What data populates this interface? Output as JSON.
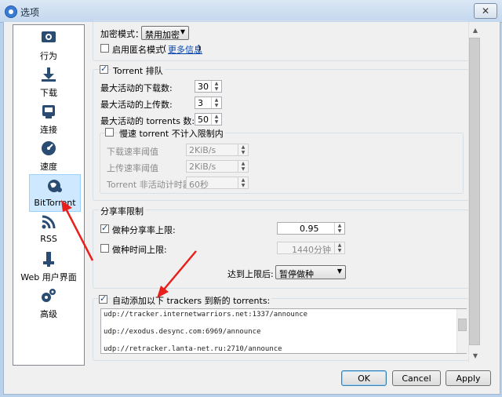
{
  "window": {
    "title": "选项",
    "close_glyph": "✕"
  },
  "sidebar": {
    "items": [
      {
        "label": "行为",
        "icon": "behavior-gear-icon"
      },
      {
        "label": "下载",
        "icon": "download-icon"
      },
      {
        "label": "连接",
        "icon": "network-connection-icon"
      },
      {
        "label": "速度",
        "icon": "speedometer-icon"
      },
      {
        "label": "BitTorrent",
        "icon": "bittorrent-globe-icon"
      },
      {
        "label": "RSS",
        "icon": "rss-icon"
      },
      {
        "label": "Web 用户界面",
        "icon": "web-ui-icon"
      },
      {
        "label": "高级",
        "icon": "advanced-gears-icon"
      }
    ],
    "selected": "BitTorrent"
  },
  "privacy": {
    "encryption_label": "加密模式：",
    "encryption_value": "禁用加密",
    "anonymous_label": "启用匿名模式",
    "anonymous_checked": false,
    "more_info_paren_open": "(",
    "more_info_link": "更多信息",
    "more_info_paren_close": ")"
  },
  "queue": {
    "title": "Torrent 排队",
    "checked": true,
    "max_downloads_label": "最大活动的下载数:",
    "max_downloads": "30",
    "max_uploads_label": "最大活动的上传数:",
    "max_uploads": "3",
    "max_torrents_label": "最大活动的 torrents 数:",
    "max_torrents": "50",
    "slow_group": {
      "title": "慢速 torrent 不计入限制内",
      "checked": false,
      "download_rate_label": "下载速率阈值",
      "download_rate": "2KiB/s",
      "upload_rate_label": "上传速率阈值",
      "upload_rate": "2KiB/s",
      "inactive_timer_label": "Torrent 非活动计时器",
      "inactive_timer": "60秒"
    }
  },
  "share_ratio": {
    "title": "分享率限制",
    "seed_ratio_label": "做种分享率上限:",
    "seed_ratio_checked": true,
    "seed_ratio": "0.95",
    "seed_time_label": "做种时间上限:",
    "seed_time_checked": false,
    "seed_time": "1440分钟",
    "after_label": "达到上限后:",
    "after_value": "暂停做种"
  },
  "trackers": {
    "label": "自动添加以下 trackers 到新的 torrents:",
    "checked": true,
    "lines": [
      "udp://tracker.internetwarriors.net:1337/announce",
      "udp://exodus.desync.com:6969/announce",
      "udp://retracker.lanta-net.ru:2710/announce"
    ]
  },
  "buttons": {
    "ok": "OK",
    "cancel": "Cancel",
    "apply": "Apply"
  },
  "colors": {
    "arrow": "#e8201c",
    "selected_bg": "#cde8ff",
    "link": "#0645ad"
  }
}
